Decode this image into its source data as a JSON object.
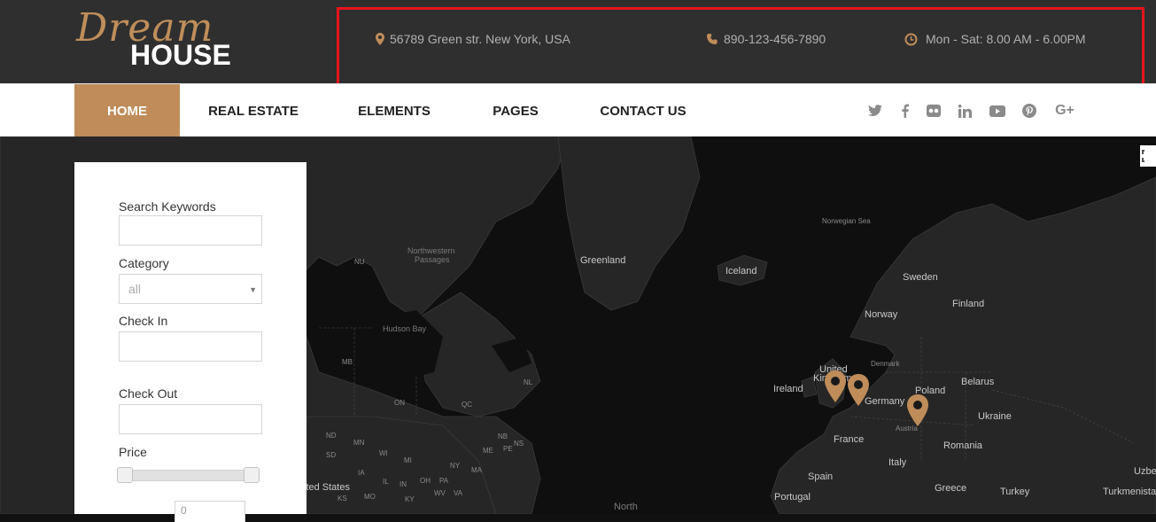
{
  "header": {
    "logo_script": "Dream",
    "logo_house": "HOUSE",
    "address": "56789 Green str. New York, USA",
    "phone": "890-123-456-7890",
    "hours": "Mon - Sat: 8.00 AM - 6.00PM",
    "accent_color": "#bf8c5a",
    "highlight_color": "#e8141b"
  },
  "nav": {
    "items": [
      {
        "label": "HOME",
        "active": true
      },
      {
        "label": "REAL ESTATE",
        "active": false
      },
      {
        "label": "ELEMENTS",
        "active": false
      },
      {
        "label": "PAGES",
        "active": false
      },
      {
        "label": "CONTACT US",
        "active": false
      }
    ],
    "social": [
      "twitter-icon",
      "facebook-icon",
      "flickr-icon",
      "linkedin-icon",
      "youtube-icon",
      "pinterest-icon",
      "google-plus-icon"
    ],
    "social_glyphs": {
      "google_plus": "G+"
    }
  },
  "search": {
    "keywords_label": "Search Keywords",
    "keywords_value": "",
    "category_label": "Category",
    "category_value": "all",
    "checkin_label": "Check In",
    "checkin_value": "",
    "checkout_label": "Check Out",
    "checkout_value": "",
    "price_label": "Price",
    "price_value": "0",
    "price_range": [
      0,
      1
    ]
  },
  "map": {
    "labels": {
      "norwegian_sea": "Norwegian Sea",
      "greenland": "Greenland",
      "iceland": "Iceland",
      "sweden": "Sweden",
      "norway": "Norway",
      "finland": "Finland",
      "united": "United",
      "kingdom": "Kingdom",
      "denmark": "Denmark",
      "ireland": "Ireland",
      "belarus": "Belarus",
      "poland": "Poland",
      "germany": "Germany",
      "ukraine": "Ukraine",
      "austria": "Austria",
      "france": "France",
      "romania": "Romania",
      "italy": "Italy",
      "spain": "Spain",
      "greece": "Greece",
      "turkey": "Turkey",
      "portugal": "Portugal",
      "turkmenista": "Turkmenista",
      "uzbe": "Uzbe",
      "north": "North",
      "northwestern": "Northwestern",
      "passages": "Passages",
      "hudson_bay": "Hudson Bay",
      "nu": "NU",
      "mb": "MB",
      "on": "ON",
      "qc": "QC",
      "nl": "NL",
      "nd": "ND",
      "sd": "SD",
      "mn": "MN",
      "wi": "WI",
      "mi": "MI",
      "ny": "NY",
      "nb": "NB",
      "ns": "NS",
      "pe": "PE",
      "me": "ME",
      "ma": "MA",
      "pa": "PA",
      "ia": "IA",
      "il": "IL",
      "in": "IN",
      "oh": "OH",
      "va": "VA",
      "ks": "KS",
      "mo": "MO",
      "ky": "KY",
      "wv": "WV",
      "ited_states": "ited States"
    }
  }
}
